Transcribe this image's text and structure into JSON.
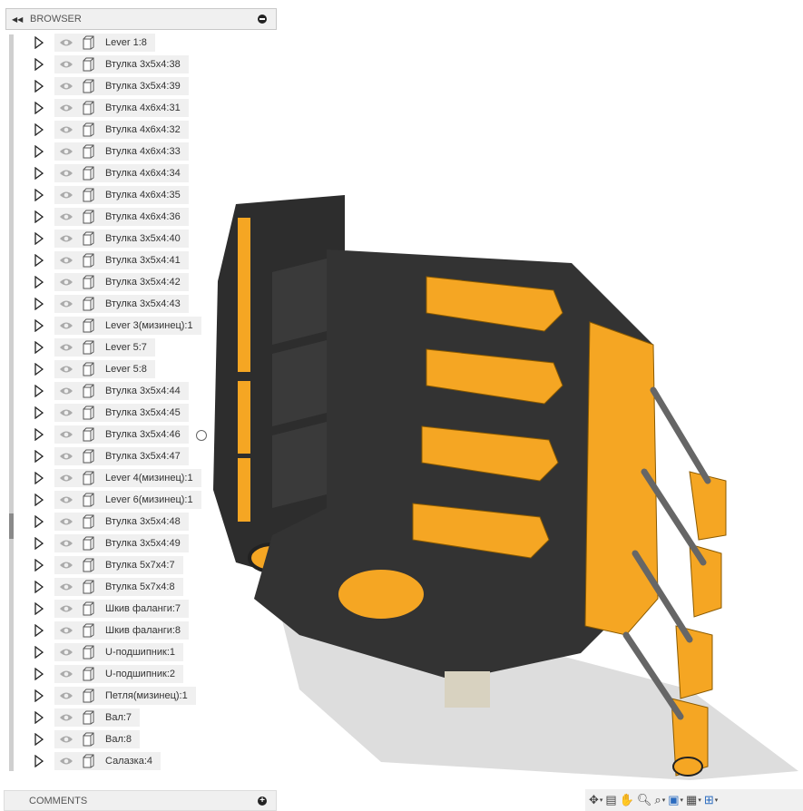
{
  "browser": {
    "title": "BROWSER",
    "items": [
      "Lever 1:8",
      "Втулка 3x5x4:38",
      "Втулка 3x5x4:39",
      "Втулка 4x6x4:31",
      "Втулка 4x6x4:32",
      "Втулка 4x6x4:33",
      "Втулка 4x6x4:34",
      "Втулка 4x6x4:35",
      "Втулка 4x6x4:36",
      "Втулка 3x5x4:40",
      "Втулка 3x5x4:41",
      "Втулка 3x5x4:42",
      "Втулка 3x5x4:43",
      "Lever 3(мизинец):1",
      "Lever 5:7",
      "Lever 5:8",
      "Втулка 3x5x4:44",
      "Втулка 3x5x4:45",
      "Втулка 3x5x4:46",
      "Втулка 3x5x4:47",
      "Lever 4(мизинец):1",
      "Lever 6(мизинец):1",
      "Втулка 3x5x4:48",
      "Втулка 3x5x4:49",
      "Втулка 5x7x4:7",
      "Втулка 5x7x4:8",
      "Шкив фаланги:7",
      "Шкив фаланги:8",
      "U-подшипник:1",
      "U-подшипник:2",
      "Петля(мизинец):1",
      "Вал:7",
      "Вал:8",
      "Салазка:4"
    ]
  },
  "comments": {
    "title": "COMMENTS"
  },
  "colors": {
    "orange": "#f5a623",
    "dark": "#2b2b2b",
    "panel": "#f0f0f0"
  },
  "navbar": {
    "icons": [
      "orbit-icon",
      "look-at-icon",
      "pan-icon",
      "zoom-icon",
      "fit-icon",
      "display-settings-icon",
      "grid-icon",
      "viewports-icon"
    ]
  }
}
